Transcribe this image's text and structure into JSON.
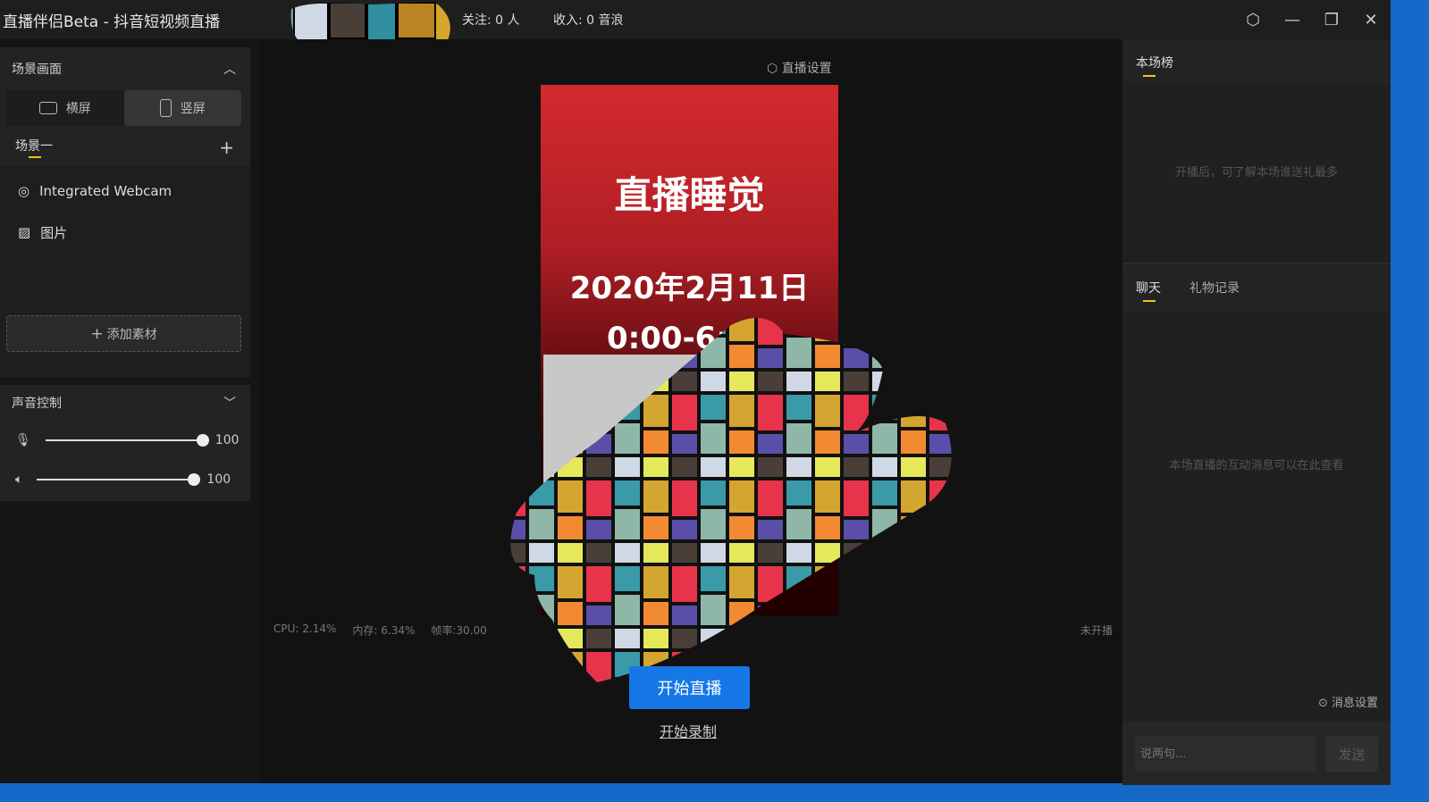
{
  "window": {
    "title": "直播伴侣Beta - 抖音短视频直播",
    "follow": "关注: 0 人",
    "income": "收入: 0 音浪"
  },
  "scene_panel": {
    "title": "场景画面",
    "landscape": "横屏",
    "portrait": "竖屏",
    "scene_tab": "场景一",
    "sources": [
      "Integrated Webcam",
      "图片"
    ],
    "add_source": "添加素材"
  },
  "audio_panel": {
    "title": "声音控制",
    "mic_volume": "100",
    "speaker_volume": "100"
  },
  "preview": {
    "settings": "直播设置",
    "line1": "直播睡觉",
    "line2": "2020年2月11日",
    "line3": "0:00-6:",
    "cpu": "CPU: 2.14%",
    "memory": "内存: 6.34%",
    "fps": "帧率:30.00",
    "status": "未开播",
    "start_live": "开始直播",
    "start_record": "开始录制"
  },
  "ranking": {
    "tab": "本场榜",
    "hint": "开播后，可了解本场谁送礼最多"
  },
  "chat": {
    "tabs": [
      "聊天",
      "礼物记录"
    ],
    "hint": "本场直播的互动消息可以在此查看",
    "msg_settings": "消息设置",
    "placeholder": "说两句...",
    "send": "发送"
  }
}
